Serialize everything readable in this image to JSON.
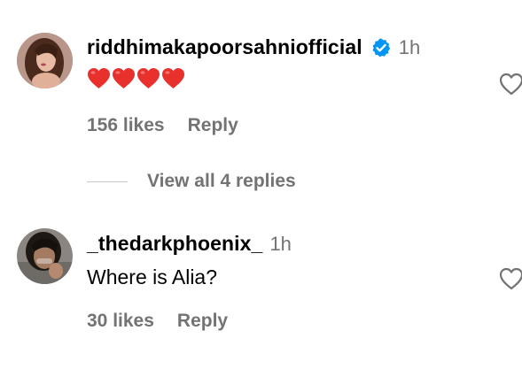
{
  "comments": [
    {
      "username": "riddhimakapoorsahniofficial",
      "verified": true,
      "time": "1h",
      "hearts": [
        "red-heart",
        "red-heart",
        "red-heart",
        "red-heart"
      ],
      "likes": "156 likes",
      "reply_label": "Reply",
      "avatar_icon": "profile-photo-woman-long-hair"
    },
    {
      "username": "_thedarkphoenix_",
      "verified": false,
      "time": "1h",
      "text": "Where is Alia?",
      "likes": "30 likes",
      "reply_label": "Reply",
      "avatar_icon": "profile-photo-person-dark-hair"
    }
  ],
  "view_replies_label": "View all 4 replies",
  "colors": {
    "secondary_text": "#737373",
    "verified_badge": "#0095f6",
    "heart_red": "#e8312d"
  },
  "icons": {
    "like": "heart-outline-icon",
    "verified": "verified-badge-icon",
    "emoji": "red-heart-emoji"
  }
}
